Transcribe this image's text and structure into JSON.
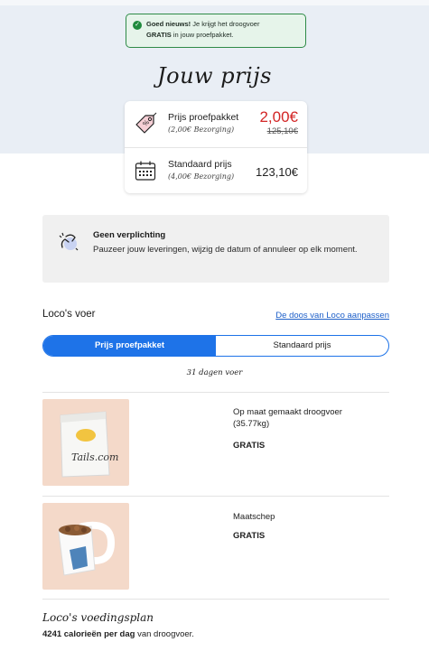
{
  "notice": {
    "bold": "Goed nieuws!",
    "text1": " Je krijgt het droogvoer",
    "bold2": "GRATIS",
    "text2": " in jouw proefpakket."
  },
  "title": "Jouw prijs",
  "prices": {
    "trial": {
      "label": "Prijs proefpakket",
      "sub": "(2,00€ Bezorging)",
      "value": "2,00€",
      "old": "125,10€"
    },
    "standard": {
      "label": "Standaard prijs",
      "sub": "(4,00€ Bezorging)",
      "value": "123,10€"
    }
  },
  "no_commitment": {
    "heading": "Geen verplichting",
    "text": "Pauzeer jouw leveringen, wijzig de datum of annuleer op elk moment."
  },
  "food_section": {
    "title": "Loco's voer",
    "link": "De doos van Loco aanpassen"
  },
  "toggle": {
    "options": [
      "Prijs proefpakket",
      "Standaard prijs"
    ],
    "active": "Prijs proefpakket"
  },
  "days_text": "31 dagen voer",
  "products": [
    {
      "name": "Op maat gemaakt droogvoer (35.77kg)",
      "price": "GRATIS",
      "image_brand": "Tails.com"
    },
    {
      "name": "Maatschep",
      "price": "GRATIS"
    }
  ],
  "plan": {
    "title": "Loco's voedingsplan",
    "bold": "4241 calorieën per dag",
    "text": " van droogvoer."
  },
  "colors": {
    "accent": "#1e73e8",
    "price_red": "#d32626",
    "notice_green": "#2e8b47",
    "hero_bg": "#e9eef5",
    "product_bg": "#f4d9c9"
  }
}
